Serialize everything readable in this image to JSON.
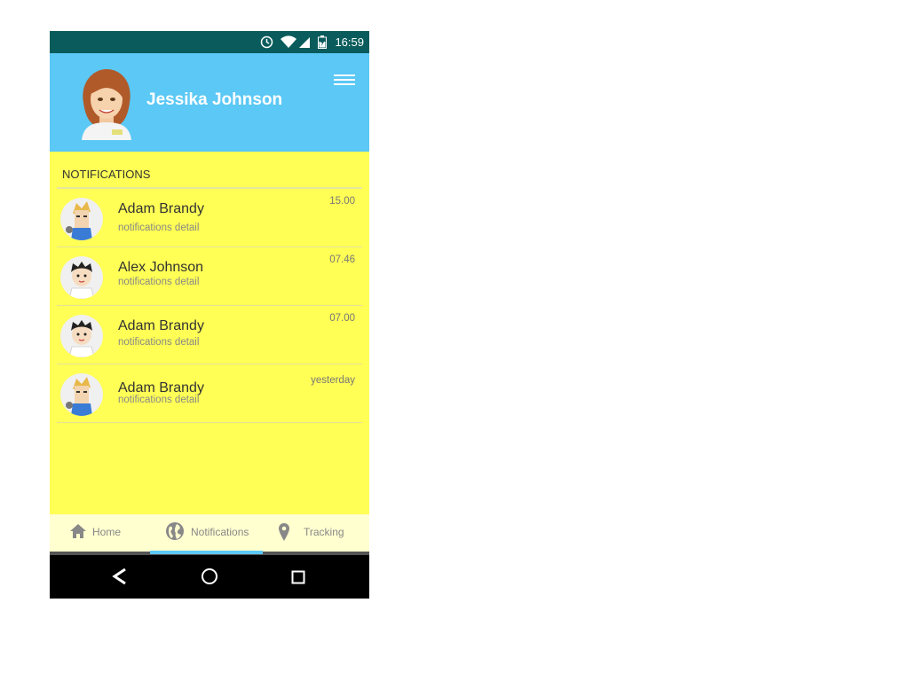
{
  "status_bar": {
    "time": "16:59",
    "icons": [
      "alarm-icon",
      "wifi-icon",
      "signal-icon",
      "battery-charging-icon"
    ]
  },
  "header": {
    "profile_name": "Jessika Johnson",
    "avatar": "woman-avatar",
    "menu_icon": "hamburger-menu-icon",
    "background_color": "#5bc8f5"
  },
  "notifications": {
    "section_title": "NOTIFICATIONS",
    "items": [
      {
        "name": "Adam Brandy",
        "detail": "notifications detail",
        "time": "15.00",
        "avatar": "blond-man-avatar"
      },
      {
        "name": "Alex Johnson",
        "detail": "notifications detail",
        "time": "07.46",
        "avatar": "dark-hair-boy-avatar"
      },
      {
        "name": "Adam Brandy",
        "detail": "notifications detail",
        "time": "07.00",
        "avatar": "dark-hair-boy-avatar"
      },
      {
        "name": "Adam Brandy",
        "detail": "notifications detail",
        "time": "yesterday",
        "avatar": "blond-man-avatar"
      }
    ],
    "background_color": "#ffff55"
  },
  "tabs": [
    {
      "label": "Home",
      "icon": "home-icon"
    },
    {
      "label": "Notifications",
      "icon": "globe-icon",
      "active": true
    },
    {
      "label": "Tracking",
      "icon": "location-pin-icon"
    }
  ],
  "nav_bar": {
    "buttons": [
      "back-icon",
      "home-circle-icon",
      "recents-square-icon"
    ]
  }
}
